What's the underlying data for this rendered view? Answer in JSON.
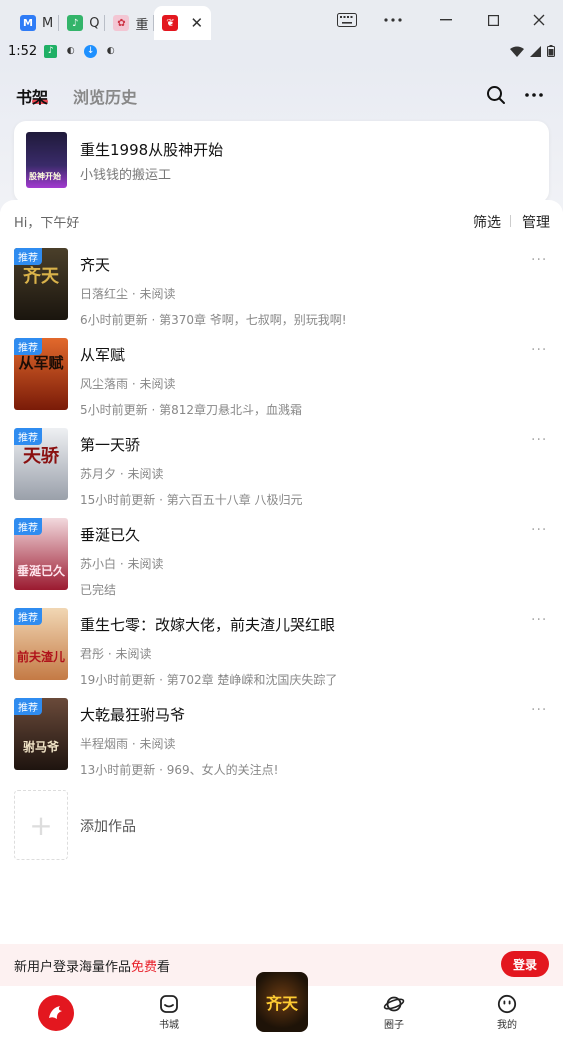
{
  "browser": {
    "tabs": [
      {
        "label": "M",
        "favicon_color": "#2f7cf6",
        "favicon_glyph": "M"
      },
      {
        "label": "Q",
        "favicon_color": "#33b46a",
        "favicon_glyph": "♪"
      },
      {
        "label": "重",
        "favicon_color": "#f3c6d3",
        "favicon_glyph": "✿"
      },
      {
        "label": "",
        "favicon_color": "#e3171f",
        "favicon_glyph": "❦"
      }
    ],
    "active_close": "✕"
  },
  "statusbar": {
    "time": "1:52"
  },
  "header": {
    "tab_bookshelf": "书架",
    "tab_history": "浏览历史"
  },
  "recent": {
    "title": "重生1998从股神开始",
    "author": "小钱钱的搬运工",
    "cover_text": "股神开始"
  },
  "shelf": {
    "greeting": "Hi，下午好",
    "filter": "筛选",
    "manage": "管理",
    "books": [
      {
        "badge": "推荐",
        "title": "齐天",
        "meta": "日落红尘 · 未阅读",
        "update": "6小时前更新 · 第370章 爷啊，七叔啊，别玩我啊!",
        "cover_text": "齐天",
        "cover_bg": "#2b2418",
        "cover_fg": "#d9b24a"
      },
      {
        "badge": "推荐",
        "title": "从军赋",
        "meta": "风尘落雨 · 未阅读",
        "update": "5小时前更新 · 第812章刀悬北斗，血溅霜",
        "cover_text": "从军赋",
        "cover_bg": "#c2411c",
        "cover_fg": "#1a0d06"
      },
      {
        "badge": "推荐",
        "title": "第一天骄",
        "meta": "苏月夕 · 未阅读",
        "update": "15小时前更新 · 第六百五十八章 八极归元",
        "cover_text": "天骄",
        "cover_bg": "#d6d9de",
        "cover_fg": "#8a1010"
      },
      {
        "badge": "推荐",
        "title": "垂涎已久",
        "meta": "苏小白 · 未阅读",
        "update": "已完结",
        "cover_text": "垂涎已久",
        "cover_bg": "#b0213a",
        "cover_fg": "#ffe6ee"
      },
      {
        "badge": "推荐",
        "title": "重生七零：改嫁大佬，前夫渣儿哭红眼",
        "meta": "君彤 · 未阅读",
        "update": "19小时前更新 · 第702章 楚峥嵘和沈国庆失踪了",
        "cover_text": "前夫渣儿",
        "cover_bg": "#e7c29a",
        "cover_fg": "#b0121a"
      },
      {
        "badge": "推荐",
        "title": "大乾最狂驸马爷",
        "meta": "半程烟雨 · 未阅读",
        "update": "13小时前更新 · 969、女人的关注点!",
        "cover_text": "驸马爷",
        "cover_bg": "#3b2a22",
        "cover_fg": "#f2e5c8"
      }
    ],
    "more_glyph": "···",
    "add_label": "添加作品",
    "add_glyph": "+"
  },
  "promo": {
    "text_before": "新用户登录海量作品",
    "text_free": "免费",
    "text_after": "看",
    "login_button": "登录"
  },
  "bottomnav": {
    "bookstore": "书城",
    "circle": "圈子",
    "mine": "我的",
    "center_text": "齐天"
  }
}
